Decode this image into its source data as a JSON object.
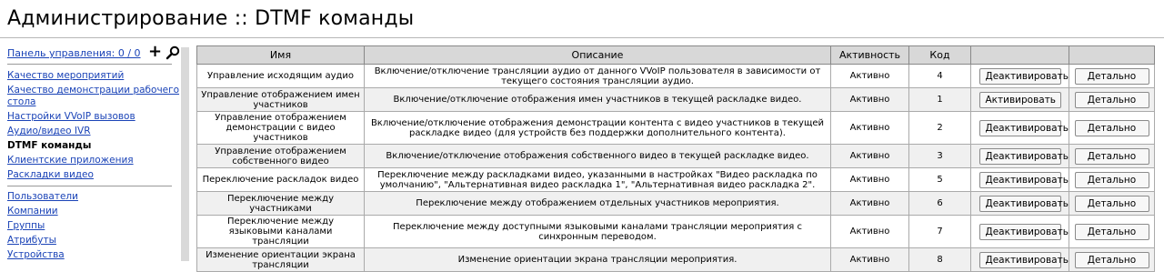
{
  "page": {
    "title": "Администрирование :: DTMF команды"
  },
  "sidebar": {
    "panel_link": "Панель управления: 0 / 0",
    "add_icon": "plus-icon",
    "search_icon": "search-icon",
    "group1": [
      {
        "label": "Качество мероприятий",
        "active": false
      },
      {
        "label": "Качество демонстрации рабочего стола",
        "active": false
      },
      {
        "label": "Настройки VVoIP вызовов",
        "active": false
      },
      {
        "label": "Аудио/видео IVR",
        "active": false
      },
      {
        "label": "DTMF команды",
        "active": true
      },
      {
        "label": "Клиентские приложения",
        "active": false
      },
      {
        "label": "Раскладки видео",
        "active": false
      }
    ],
    "group2": [
      {
        "label": "Пользователи"
      },
      {
        "label": "Компании"
      },
      {
        "label": "Группы"
      },
      {
        "label": "Атрибуты"
      },
      {
        "label": "Устройства"
      }
    ]
  },
  "table": {
    "headers": [
      "Имя",
      "Описание",
      "Активность",
      "Код",
      "",
      ""
    ],
    "rows": [
      {
        "name": "Управление исходящим аудио",
        "description": "Включение/отключение трансляции аудио от данного VVoIP пользователя в зависимости от текущего состояния трансляции аудио.",
        "status": "Активно",
        "code": "4",
        "action": "Деактивировать",
        "details": "Детально"
      },
      {
        "name": "Управление отображением имен участников",
        "description": "Включение/отключение отображения имен участников в текущей раскладке видео.",
        "status": "Активно",
        "code": "1",
        "action": "Активировать",
        "details": "Детально"
      },
      {
        "name": "Управление отображением демонстрации с видео участников",
        "description": "Включение/отключение отображения демонстрации контента с видео участников в текущей раскладке видео (для устройств без поддержки дополнительного контента).",
        "status": "Активно",
        "code": "2",
        "action": "Деактивировать",
        "details": "Детально"
      },
      {
        "name": "Управление отображением собственного видео",
        "description": "Включение/отключение отображения собственного видео в текущей раскладке видео.",
        "status": "Активно",
        "code": "3",
        "action": "Деактивировать",
        "details": "Детально"
      },
      {
        "name": "Переключение раскладок видео",
        "description": "Переключение между раскладками видео, указанными в настройках \"Видео раскладка по умолчанию\", \"Альтернативная видео раскладка 1\", \"Альтернативная видео раскладка 2\".",
        "status": "Активно",
        "code": "5",
        "action": "Деактивировать",
        "details": "Детально"
      },
      {
        "name": "Переключение между участниками",
        "description": "Переключение между отображением отдельных участников мероприятия.",
        "status": "Активно",
        "code": "6",
        "action": "Деактивировать",
        "details": "Детально"
      },
      {
        "name": "Переключение между языковыми каналами трансляции",
        "description": "Переключение между доступными языковыми каналами трансляции мероприятия с синхронным переводом.",
        "status": "Активно",
        "code": "7",
        "action": "Деактивировать",
        "details": "Детально"
      },
      {
        "name": "Изменение ориентации экрана трансляции",
        "description": "Изменение ориентации экрана трансляции мероприятия.",
        "status": "Активно",
        "code": "8",
        "action": "Деактивировать",
        "details": "Детально"
      }
    ]
  }
}
